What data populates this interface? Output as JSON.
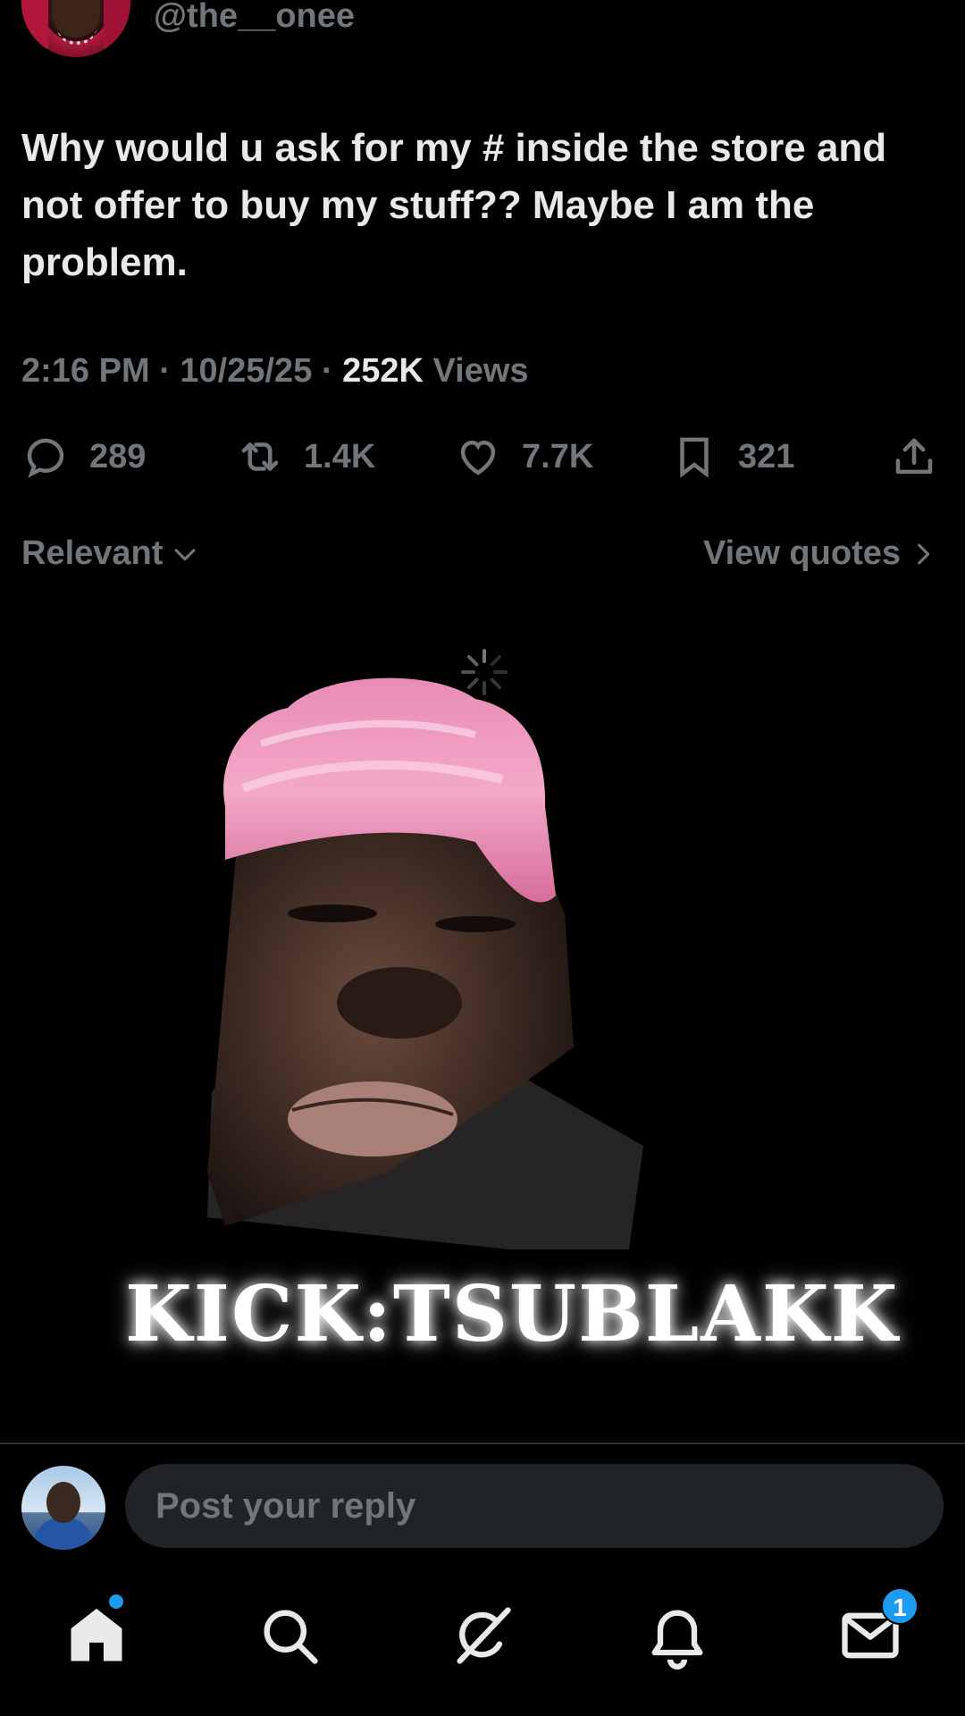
{
  "post": {
    "handle": "@the__onee",
    "text": "Why would u ask for my # inside the store and not offer to buy my stuff?? Maybe I am the problem.",
    "time": "2:16 PM",
    "date": "10/25/25",
    "sep": "·",
    "views_count": "252K",
    "views_label": "Views"
  },
  "actions": {
    "replies": "289",
    "reposts": "1.4K",
    "likes": "7.7K",
    "bookmarks": "321"
  },
  "sort": {
    "relevant_label": "Relevant",
    "view_quotes_label": "View quotes"
  },
  "overlay": {
    "watermark": "KICK:TSUBLAKK"
  },
  "reply": {
    "placeholder": "Post your reply"
  },
  "nav": {
    "messages_badge": "1"
  },
  "colors": {
    "background": "#000000",
    "text": "#e7e9ea",
    "muted": "#71767b",
    "accent": "#1d9bf0",
    "input_bg": "#202327"
  },
  "icons": [
    "reply-icon",
    "repost-icon",
    "like-icon",
    "bookmark-icon",
    "share-icon",
    "chevron-down-icon",
    "chevron-right-icon",
    "loading-spinner-icon",
    "home-icon",
    "search-icon",
    "grok-icon",
    "notifications-icon",
    "messages-icon"
  ]
}
